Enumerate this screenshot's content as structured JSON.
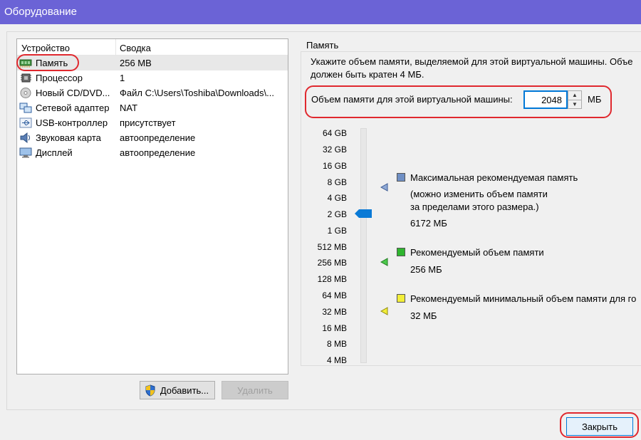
{
  "window": {
    "title": "Оборудование"
  },
  "device_list": {
    "columns": [
      "Устройство",
      "Сводка"
    ],
    "rows": [
      {
        "icon": "memory-icon",
        "name": "Память",
        "summary": "256 MB",
        "selected": true
      },
      {
        "icon": "processor-icon",
        "name": "Процессор",
        "summary": "1"
      },
      {
        "icon": "cd-dvd-icon",
        "name": "Новый CD/DVD...",
        "summary": "Файл C:\\Users\\Toshiba\\Downloads\\..."
      },
      {
        "icon": "network-adapter-icon",
        "name": "Сетевой адаптер",
        "summary": "NAT"
      },
      {
        "icon": "usb-icon",
        "name": "USB-контроллер",
        "summary": "присутствует"
      },
      {
        "icon": "sound-card-icon",
        "name": "Звуковая карта",
        "summary": "автоопределение"
      },
      {
        "icon": "display-icon",
        "name": "Дисплей",
        "summary": "автоопределение"
      }
    ],
    "add_button": "Добавить...",
    "remove_button": "Удалить"
  },
  "memory_panel": {
    "group_title": "Память",
    "description_line1": "Укажите объем памяти, выделяемой для этой виртуальной машины. Объе",
    "description_line2": "должен быть кратен 4 МБ.",
    "field_label": "Объем памяти для этой виртуальной машины:",
    "value": "2048",
    "unit": "МБ",
    "scale_labels": [
      "64 GB",
      "32 GB",
      "16 GB",
      "8 GB",
      "4 GB",
      "2 GB",
      "1 GB",
      "512 MB",
      "256 MB",
      "128 MB",
      "64 MB",
      "32 MB",
      "16 MB",
      "8 MB",
      "4 MB"
    ],
    "legend": {
      "max": {
        "title": "Максимальная рекомендуемая память",
        "note1": "(можно изменить объем памяти",
        "note2": "за пределами этого размера.)",
        "value": "6172 МБ",
        "color": "#6f8fc4"
      },
      "recommended": {
        "title": "Рекомендуемый объем памяти",
        "value": "256 МБ",
        "color": "#2fb52f"
      },
      "min": {
        "title": "Рекомендуемый минимальный объем памяти для го",
        "value": "32 МБ",
        "color": "#f2ee39"
      }
    }
  },
  "footer": {
    "close_button": "Закрыть"
  },
  "colors": {
    "titlebar": "#6b63d6",
    "highlight": "#e0282e",
    "thumb": "#0a7ad6"
  }
}
